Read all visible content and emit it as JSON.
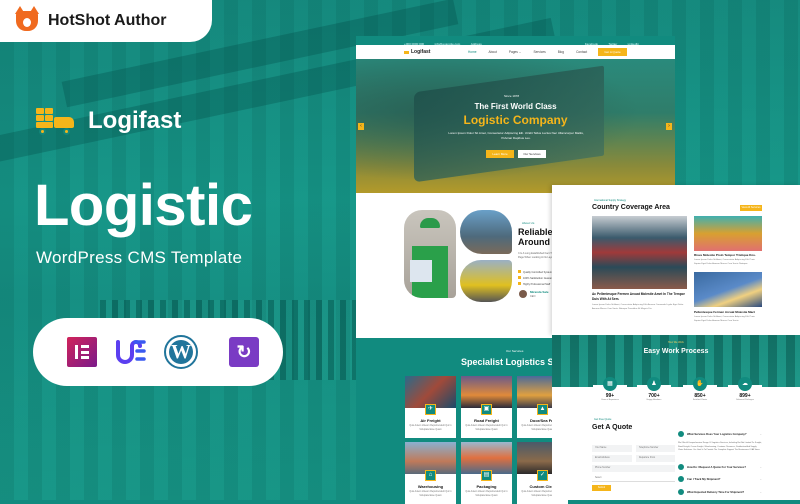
{
  "badge": {
    "label": "HotShot Author",
    "icon": "fox-icon"
  },
  "brand": {
    "name": "Logifast",
    "icon": "delivery-truck-icon"
  },
  "headline": "Logistic",
  "subline": "WordPress CMS Template",
  "plugins": [
    {
      "name": "Elementor",
      "icon": "elementor-icon"
    },
    {
      "name": "UE",
      "icon": "unlimited-elements-icon"
    },
    {
      "name": "WordPress",
      "icon": "wordpress-icon",
      "glyph": "W"
    },
    {
      "name": "Revolution Slider",
      "icon": "revslider-icon",
      "glyph": "↻"
    }
  ],
  "preview": {
    "topbar": {
      "left": [
        "+000 0000 000",
        "info@example.com",
        "Address"
      ],
      "right": [
        "Facebook",
        "Twitter",
        "LinkedIn"
      ]
    },
    "nav": {
      "logo": "Logifast",
      "links": [
        "Home",
        "About",
        "Pages ⌄",
        "Services",
        "Blog",
        "Contact"
      ],
      "cta": "Get A Quote"
    },
    "hero": {
      "tag": "Since 1978",
      "line1": "The First World Class",
      "line2": "Logistic Company",
      "paragraph": "Lorem Ipsum Dolor Sit Amet, Consectetur Adipiscing Elit. Ut Elit Tellus Luctus Nec Ullamcorper Mattis, Pulvinar Dapibus Leo.",
      "primary_btn": "Learn More",
      "secondary_btn": "Our Services",
      "prev": "‹",
      "next": "›"
    },
    "about": {
      "tag": "About Us",
      "title_l1": "Reliable T",
      "title_l2": "Around T",
      "paragraph": "It Is A Long Established Fact That A Page When Looking At Its Layout.",
      "list": [
        "Quality Controlled System",
        "100% Satisfaction Guarantee",
        "Highly Professional Staff"
      ],
      "person_name": "Miranda Sale",
      "person_role": "CEO"
    },
    "services": {
      "tag": "Our Services",
      "title": "Specialist Logistics Serv",
      "cards": [
        {
          "title": "Air Freight",
          "desc": "Quis Autem Veleum Reprehenderit Qui In Voluptate Esse Quam",
          "icon": "plane-icon"
        },
        {
          "title": "Road Freight",
          "desc": "Quis Autem Veleum Reprehenderit Qui In Voluptate Esse Quam",
          "icon": "truck-icon"
        },
        {
          "title": "Door/Sea Fre",
          "desc": "Quis Autem Veleum Reprehenderit Qui In Voluptate Esse Quam",
          "icon": "ship-icon"
        },
        {
          "title": "Warehousing",
          "desc": "Quis Autem Veleum Reprehenderit Qui In Voluptate Esse Quam",
          "icon": "warehouse-icon"
        },
        {
          "title": "Packaging",
          "desc": "Quis Autem Veleum Reprehenderit Qui In Voluptate Esse Quam",
          "icon": "package-icon"
        },
        {
          "title": "Custom Clear",
          "desc": "Quis Autem Veleum Reprehenderit Qui In Voluptate Esse Quam",
          "icon": "check-icon"
        }
      ]
    },
    "coverage": {
      "tag": "International Supply Strategy",
      "title": "Country Coverage Area",
      "button": "View All Services →",
      "main_caption": "Ac Pellentesque Fermen Arcuat Molestie Amet In The Tempor Duis With At Sem.",
      "main_desc": "Lorem Ipsum Dolor Sit Amet, Consectetur Adipiscing Elit. Aenean Commodo Ligula Eget Dolor. Aenean Massa Cum Sociis Natoque Penatibus Et Magnis Dis.",
      "side": [
        {
          "caption": "Risus Molestie Proin Tempor Tristique Dos.",
          "desc": "Lorem Ipsum Dolor Sit Amet, Consectetur Adipiscing Elit. Proin Sapien Eget Dolor Aenean Massa Cum Sociis Natoque."
        },
        {
          "caption": "Pellentesque Fermen Arcuat Molestie Mact",
          "desc": "Lorem Ipsum Dolor Sit Amet, Consectetur Adipiscing Elit. Proin Sapien Eget Dolor Aenean Massa Cum Sociis."
        }
      ]
    },
    "process": {
      "tag": "How We Work",
      "title": "Easy Work Process",
      "stats": [
        {
          "value": "99+",
          "label": "Years of Experience",
          "icon": "calendar-icon"
        },
        {
          "value": "700+",
          "label": "Happy Members",
          "icon": "team-icon"
        },
        {
          "value": "850+",
          "label": "Satisfied Clients",
          "icon": "handshake-icon"
        },
        {
          "value": "899+",
          "label": "Delivered Packages",
          "icon": "delivery-icon"
        }
      ]
    },
    "quote": {
      "tag": "Get Free Quote",
      "title": "Get A Quote",
      "fields": [
        "Your Name",
        "Telephone Number",
        "Email Address",
        "Departure From",
        "Phone Number",
        "Select"
      ],
      "submit": "Submit",
      "faqs": [
        {
          "q": "What Services Does Your Logistics Company?",
          "open": true
        },
        {
          "q": "How Do I Request A Quote For Your Services?",
          "open": false
        },
        {
          "q": "Can I Track My Shipment?",
          "open": false
        },
        {
          "q": "What Expected Delivery Time For Shipment?",
          "open": false
        }
      ],
      "faq_answer": "We Offer A Comprehensive Range Of Logistics Services, Including But Not Limited To: Freight, Road Freight, Ocean Freight, Warehousing, Customs Clearance, Distribution And Supply Chain Solutions. Our Goal Is To Provide The Complete Support The Businesses Of All Sizes.",
      "chevron": "⌄"
    }
  }
}
